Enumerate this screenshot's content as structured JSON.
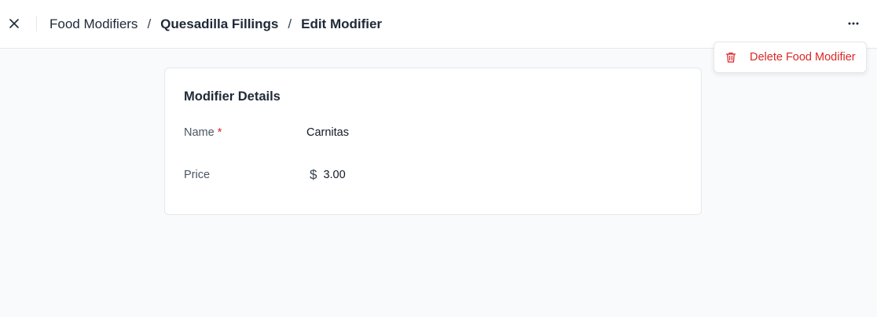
{
  "header": {
    "breadcrumb": {
      "root": "Food Modifiers",
      "sep1": "/",
      "group": "Quesadilla Fillings",
      "sep2": "/",
      "current": "Edit Modifier"
    },
    "close_icon": "close-icon",
    "more_icon": "more-horizontal-icon"
  },
  "menu": {
    "delete_label": "Delete Food Modifier",
    "delete_icon": "trash-icon",
    "color": "#dc2626"
  },
  "card": {
    "title": "Modifier Details",
    "name_label": "Name",
    "required_mark": "*",
    "name_value": "Carnitas",
    "price_label": "Price",
    "currency_symbol": "$",
    "price_value": "3.00"
  }
}
